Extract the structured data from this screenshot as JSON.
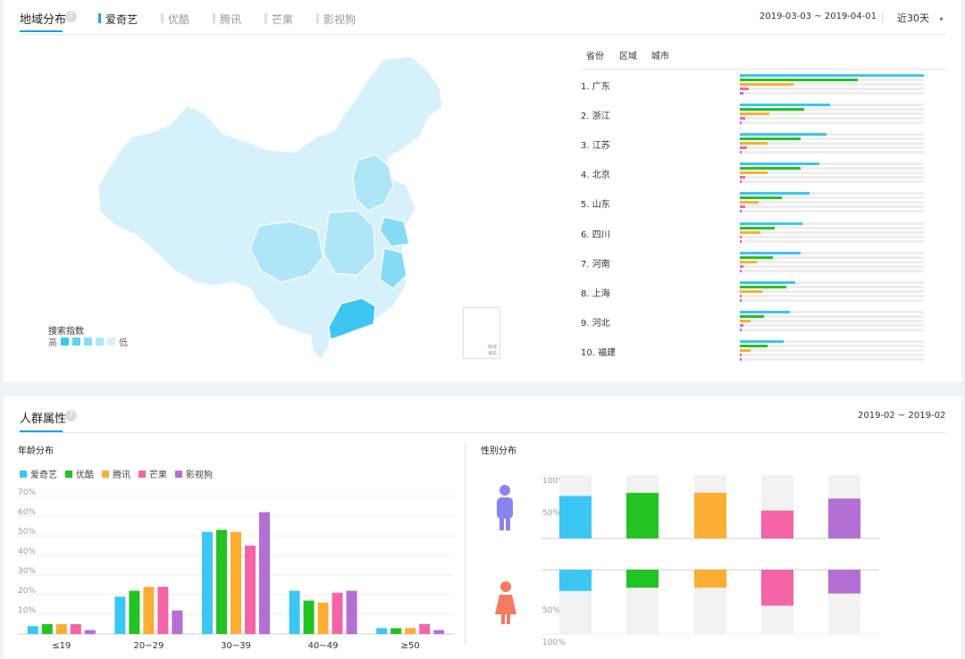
{
  "region": {
    "title": "地域分布",
    "platform_tabs": [
      "爱奇艺",
      "优酷",
      "腾讯",
      "芒果",
      "影视狗"
    ],
    "active_tab": 0,
    "date_range": "2019-03-03 ~ 2019-04-01",
    "period": "近30天",
    "view_tabs": [
      "省份",
      "区域",
      "城市"
    ],
    "legend_title": "搜索指数",
    "legend_high": "高",
    "legend_low": "低",
    "inset_label": "南海诸岛",
    "scale_colors": [
      "#3cc6f2",
      "#62d2f4",
      "#86dbf6",
      "#aee6f8",
      "#d6f1fb"
    ],
    "rankings": [
      {
        "label": "1.  广东",
        "values": [
          1.0,
          0.64,
          0.29,
          0.05,
          0.02
        ]
      },
      {
        "label": "2.  浙江",
        "values": [
          0.49,
          0.35,
          0.16,
          0.03,
          0.01
        ]
      },
      {
        "label": "3.  江苏",
        "values": [
          0.47,
          0.33,
          0.15,
          0.04,
          0.01
        ]
      },
      {
        "label": "4.  北京",
        "values": [
          0.43,
          0.33,
          0.15,
          0.03,
          0.01
        ]
      },
      {
        "label": "5.  山东",
        "values": [
          0.38,
          0.23,
          0.1,
          0.03,
          0.01
        ]
      },
      {
        "label": "6.  四川",
        "values": [
          0.34,
          0.19,
          0.11,
          0.01,
          0.005
        ]
      },
      {
        "label": "7.  河南",
        "values": [
          0.33,
          0.18,
          0.09,
          0.02,
          0.01
        ]
      },
      {
        "label": "8.  上海",
        "values": [
          0.3,
          0.25,
          0.12,
          0.01,
          0.005
        ]
      },
      {
        "label": "9.  河北",
        "values": [
          0.27,
          0.13,
          0.06,
          0.02,
          0.01
        ]
      },
      {
        "label": "10. 福建",
        "values": [
          0.24,
          0.15,
          0.06,
          0.01,
          0.005
        ]
      }
    ]
  },
  "colors": {
    "platforms": [
      "#3cc6f2",
      "#22c322",
      "#fcae32",
      "#f564a6",
      "#b36fd3"
    ],
    "accent": "#1f9bf0"
  },
  "audience": {
    "title": "人群属性",
    "date_range": "2019-02 ~ 2019-02",
    "age_title": "年龄分布",
    "gender_title": "性别分布",
    "male_icon": "male-person-icon",
    "female_icon": "female-person-icon"
  },
  "chart_data": [
    {
      "type": "bar",
      "title": "年龄分布",
      "categories": [
        "≤19",
        "20~29",
        "30~39",
        "40~49",
        "≥50"
      ],
      "y_unit": "%",
      "ylim": [
        0,
        70
      ],
      "yticks": [
        "10%",
        "20%",
        "30%",
        "40%",
        "50%",
        "60%",
        "70%"
      ],
      "grid": true,
      "legend": "top-left",
      "series": [
        {
          "name": "爱奇艺",
          "values": [
            4,
            19,
            52,
            22,
            3
          ]
        },
        {
          "name": "优酷",
          "values": [
            5,
            22,
            53,
            17,
            3
          ]
        },
        {
          "name": "腾讯",
          "values": [
            5,
            24,
            52,
            16,
            3
          ]
        },
        {
          "name": "芒果",
          "values": [
            5,
            24,
            45,
            21,
            5
          ]
        },
        {
          "name": "影视狗",
          "values": [
            2,
            12,
            62,
            22,
            2
          ]
        }
      ]
    },
    {
      "type": "bar",
      "title": "性别分布",
      "categories": [
        "爱奇艺",
        "优酷",
        "腾讯",
        "芒果",
        "影视狗"
      ],
      "male_axis_labels": [
        "100%",
        "50%"
      ],
      "female_axis_labels": [
        "50%",
        "100%"
      ],
      "male_values": [
        67,
        72,
        72,
        44,
        63
      ],
      "female_values": [
        33,
        28,
        28,
        56,
        37
      ]
    }
  ]
}
